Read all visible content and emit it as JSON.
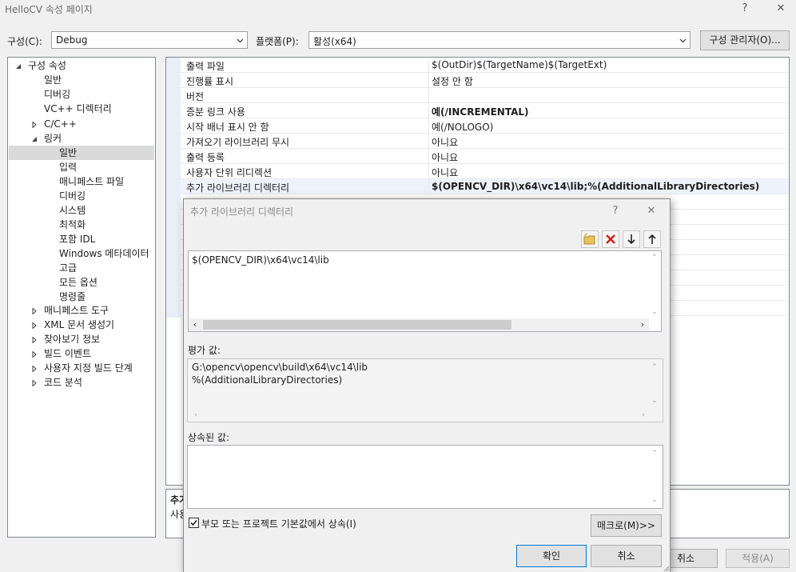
{
  "window": {
    "title": "HelloCV 속성 페이지",
    "help_glyph": "?",
    "close_glyph": "✕"
  },
  "toolbar": {
    "config_label": "구성(C):",
    "config_value": "Debug",
    "platform_label": "플랫폼(P):",
    "platform_value": "활성(x64)",
    "config_manager_button": "구성 관리자(O)..."
  },
  "tree": {
    "root": "구성 속성",
    "items": [
      {
        "label": "일반"
      },
      {
        "label": "디버깅"
      },
      {
        "label": "VC++ 디렉터리"
      },
      {
        "label": "C/C++"
      },
      {
        "label": "링커"
      },
      {
        "label": "일반",
        "selected": true
      },
      {
        "label": "입력"
      },
      {
        "label": "매니페스트 파일"
      },
      {
        "label": "디버깅"
      },
      {
        "label": "시스템"
      },
      {
        "label": "최적화"
      },
      {
        "label": "포함 IDL"
      },
      {
        "label": "Windows 메타데이터"
      },
      {
        "label": "고급"
      },
      {
        "label": "모든 옵션"
      },
      {
        "label": "명령줄"
      },
      {
        "label": "매니페스트 도구"
      },
      {
        "label": "XML 문서 생성기"
      },
      {
        "label": "찾아보기 정보"
      },
      {
        "label": "빌드 이벤트"
      },
      {
        "label": "사용자 지정 빌드 단계"
      },
      {
        "label": "코드 분석"
      }
    ]
  },
  "properties": [
    {
      "name": "출력 파일",
      "value": "$(OutDir)$(TargetName)$(TargetExt)"
    },
    {
      "name": "진행률 표시",
      "value": "설정 안 함"
    },
    {
      "name": "버전",
      "value": ""
    },
    {
      "name": "증분 링크 사용",
      "value": "예(/INCREMENTAL)",
      "bold": true
    },
    {
      "name": "시작 배너 표시 안 함",
      "value": "예(/NOLOGO)"
    },
    {
      "name": "가져오기 라이브러리 무시",
      "value": "아니요"
    },
    {
      "name": "출력 등록",
      "value": "아니요"
    },
    {
      "name": "사용자 단위 리디렉션",
      "value": "아니요"
    },
    {
      "name": "추가 라이브러리 디렉터리",
      "value": "$(OPENCV_DIR)\\x64\\vc14\\lib;%(AdditionalLibraryDirectories)",
      "bold": true
    }
  ],
  "description": {
    "title": "추가",
    "text": "사용"
  },
  "bottom_buttons": {
    "cancel": "취소",
    "apply": "적용(A)"
  },
  "dialog": {
    "title": "추가 라이브러리 디렉터리",
    "help_glyph": "?",
    "close_glyph": "✕",
    "tools": [
      "new-folder-icon",
      "delete-icon",
      "move-down-icon",
      "move-up-icon"
    ],
    "edit_lines": [
      "$(OPENCV_DIR)\\x64\\vc14\\lib"
    ],
    "evaluated_label": "평가 값:",
    "evaluated_lines": [
      "G:\\opencv\\opencv\\build\\x64\\vc14\\lib",
      "%(AdditionalLibraryDirectories)"
    ],
    "inherited_label": "상속된 값:",
    "inherit_checkbox_label": "부모 또는 프로젝트 기본값에서 상속(I)",
    "inherit_checked": true,
    "macro_button": "매크로(M)>>",
    "ok_button": "확인",
    "cancel_button": "취소"
  },
  "colors": {
    "accent": "#0078d7",
    "delete_red": "#d02020",
    "selection": "#dadada"
  }
}
